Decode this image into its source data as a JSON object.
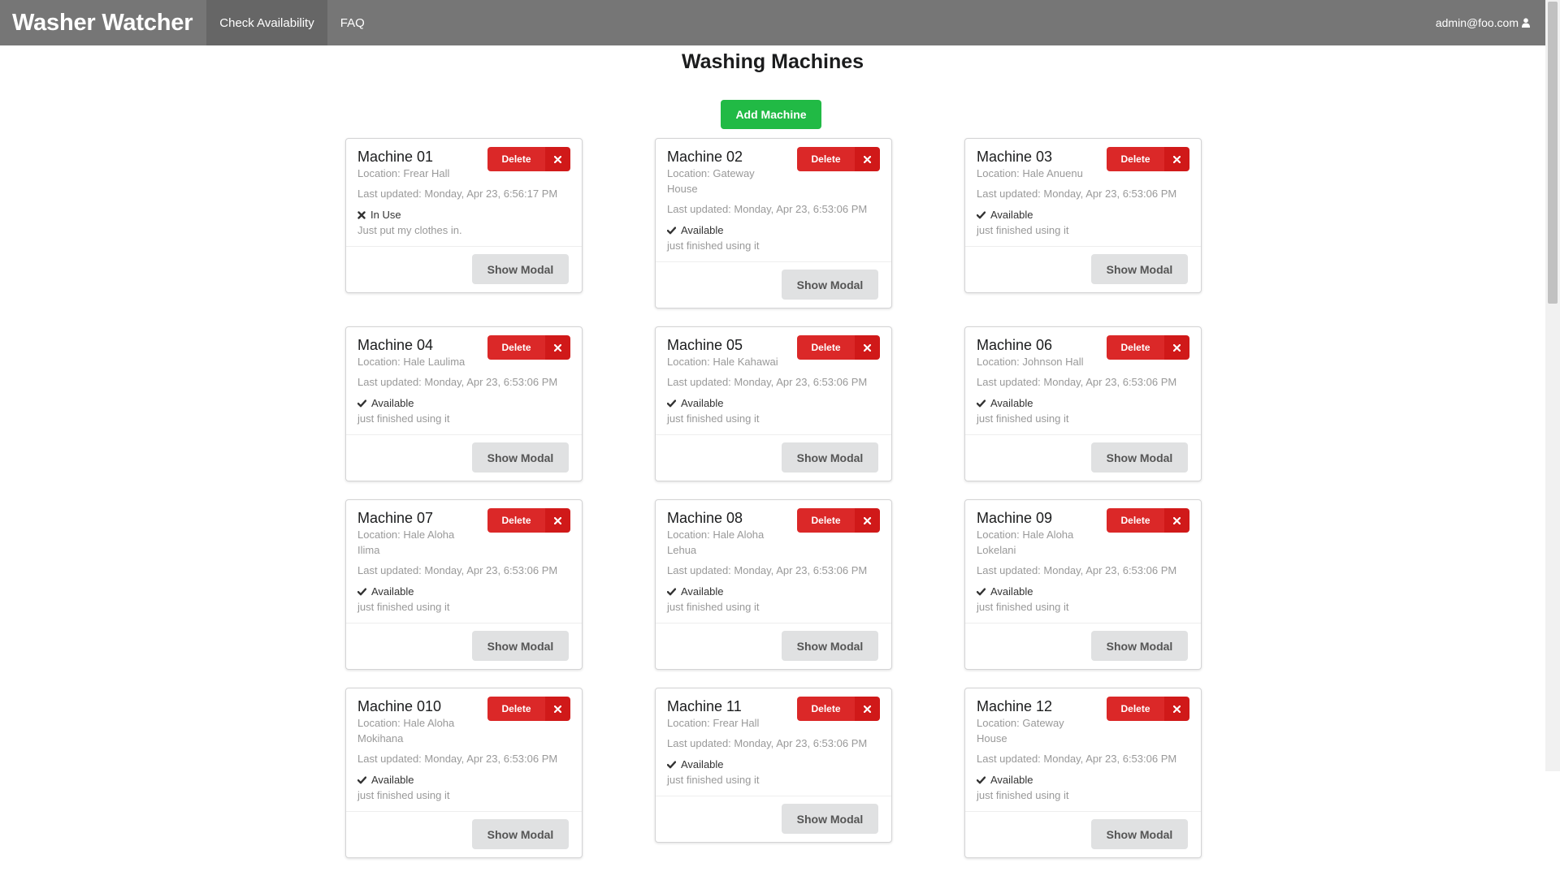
{
  "navbar": {
    "brand": "Washer Watcher",
    "links": [
      {
        "label": "Check Availability",
        "active": true
      },
      {
        "label": "FAQ",
        "active": false
      }
    ],
    "user_email": "admin@foo.com",
    "user_icon": "user-icon"
  },
  "page": {
    "title": "Washing Machines",
    "add_button_label": "Add Machine"
  },
  "labels": {
    "delete": "Delete",
    "show_modal": "Show Modal"
  },
  "colors": {
    "navbar": "#767676",
    "navbar_active": "#666666",
    "add_button": "#21ba45",
    "delete_button": "#db2828",
    "modal_button": "#e0e1e2"
  },
  "machines": [
    {
      "name": "Machine 01",
      "location": "Location: Frear Hall",
      "updated": "Last updated: Monday, Apr 23, 6:56:17 PM",
      "status": "In Use",
      "status_icon": "x-icon",
      "note": "Just put my clothes in."
    },
    {
      "name": "Machine 02",
      "location": "Location: Gateway House",
      "updated": "Last updated: Monday, Apr 23, 6:53:06 PM",
      "status": "Available",
      "status_icon": "check-icon",
      "note": "just finished using it"
    },
    {
      "name": "Machine 03",
      "location": "Location: Hale Anuenu",
      "updated": "Last updated: Monday, Apr 23, 6:53:06 PM",
      "status": "Available",
      "status_icon": "check-icon",
      "note": "just finished using it"
    },
    {
      "name": "Machine 04",
      "location": "Location: Hale Laulima",
      "updated": "Last updated: Monday, Apr 23, 6:53:06 PM",
      "status": "Available",
      "status_icon": "check-icon",
      "note": "just finished using it"
    },
    {
      "name": "Machine 05",
      "location": "Location: Hale Kahawai",
      "updated": "Last updated: Monday, Apr 23, 6:53:06 PM",
      "status": "Available",
      "status_icon": "check-icon",
      "note": "just finished using it"
    },
    {
      "name": "Machine 06",
      "location": "Location: Johnson Hall",
      "updated": "Last updated: Monday, Apr 23, 6:53:06 PM",
      "status": "Available",
      "status_icon": "check-icon",
      "note": "just finished using it"
    },
    {
      "name": "Machine 07",
      "location": "Location: Hale Aloha Ilima",
      "updated": "Last updated: Monday, Apr 23, 6:53:06 PM",
      "status": "Available",
      "status_icon": "check-icon",
      "note": "just finished using it"
    },
    {
      "name": "Machine 08",
      "location": "Location: Hale Aloha Lehua",
      "updated": "Last updated: Monday, Apr 23, 6:53:06 PM",
      "status": "Available",
      "status_icon": "check-icon",
      "note": "just finished using it"
    },
    {
      "name": "Machine 09",
      "location": "Location: Hale Aloha Lokelani",
      "updated": "Last updated: Monday, Apr 23, 6:53:06 PM",
      "status": "Available",
      "status_icon": "check-icon",
      "note": "just finished using it"
    },
    {
      "name": "Machine 010",
      "location": "Location: Hale Aloha Mokihana",
      "updated": "Last updated: Monday, Apr 23, 6:53:06 PM",
      "status": "Available",
      "status_icon": "check-icon",
      "note": "just finished using it"
    },
    {
      "name": "Machine 11",
      "location": "Location: Frear Hall",
      "updated": "Last updated: Monday, Apr 23, 6:53:06 PM",
      "status": "Available",
      "status_icon": "check-icon",
      "note": "just finished using it"
    },
    {
      "name": "Machine 12",
      "location": "Location: Gateway House",
      "updated": "Last updated: Monday, Apr 23, 6:53:06 PM",
      "status": "Available",
      "status_icon": "check-icon",
      "note": "just finished using it"
    }
  ]
}
